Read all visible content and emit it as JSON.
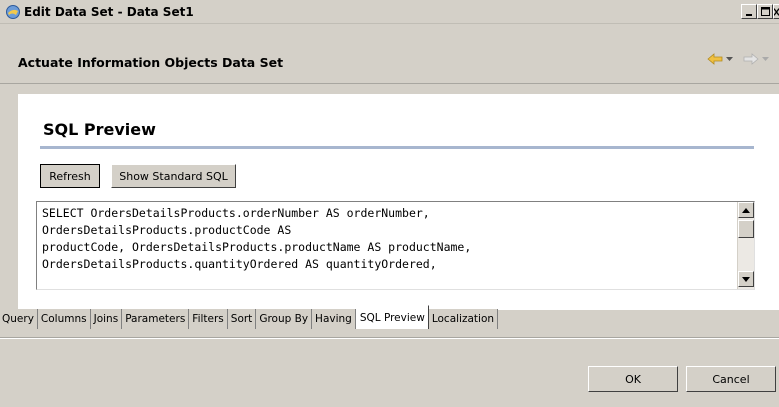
{
  "window": {
    "title": "Edit Data Set - Data Set1",
    "controls": {
      "minimize": "minimize-icon",
      "maximize": "maximize-icon",
      "close": "close-icon"
    }
  },
  "header": {
    "title": "Actuate Information Objects Data Set",
    "nav": {
      "back": "back-arrow-icon",
      "forward": "forward-arrow-icon"
    },
    "colors": {
      "back_arrow": "#f0c040",
      "forward_arrow": "#c8c8c8"
    }
  },
  "panel": {
    "title": "SQL Preview",
    "buttons": {
      "refresh": "Refresh",
      "show_standard_sql": "Show Standard SQL"
    },
    "sql_lines": [
      "SELECT OrdersDetailsProducts.orderNumber AS orderNumber,",
      "OrdersDetailsProducts.productCode AS",
      "productCode, OrdersDetailsProducts.productName AS productName,",
      "OrdersDetailsProducts.quantityOrdered AS quantityOrdered,"
    ],
    "rule_color": "#a7b6cf"
  },
  "tabs": [
    {
      "label": "Query"
    },
    {
      "label": "Columns"
    },
    {
      "label": "Joins"
    },
    {
      "label": "Parameters"
    },
    {
      "label": "Filters"
    },
    {
      "label": "Sort"
    },
    {
      "label": "Group By"
    },
    {
      "label": "Having"
    },
    {
      "label": "SQL Preview",
      "active": true
    },
    {
      "label": "Localization"
    }
  ],
  "footer": {
    "ok": "OK",
    "cancel": "Cancel"
  }
}
